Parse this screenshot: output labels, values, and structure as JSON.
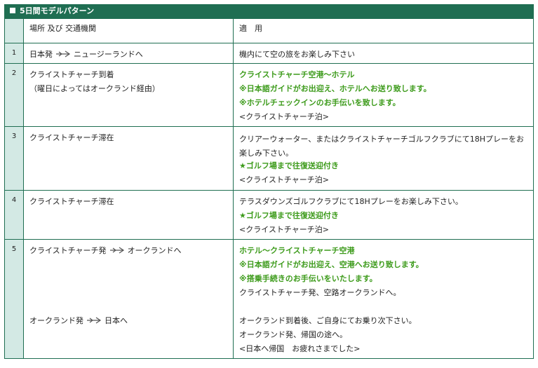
{
  "title": "5日間モデルパターン",
  "headers": {
    "location": "場所 及び 交通機関",
    "usage": "適　用"
  },
  "rows": [
    {
      "num": "1",
      "loc1_pre": "日本発",
      "loc1_post": "ニュージーランドへ",
      "lines": [
        {
          "text": "機内にて空の旅をお楽しみ下さい",
          "style": "normal"
        }
      ]
    },
    {
      "num": "2",
      "loc1": "クライストチャーチ到着",
      "loc2": "（曜日によってはオークランド経由）",
      "lines": [
        {
          "text": "クライストチャーチ空港〜ホテル",
          "style": "green"
        },
        {
          "text": "※日本語ガイドがお出迎え、ホテルへお送り致します。",
          "style": "green"
        },
        {
          "text": "※ホテルチェックインのお手伝いを致します。",
          "style": "green"
        },
        {
          "text": "<クライストチャーチ泊>",
          "style": "normal"
        }
      ]
    },
    {
      "num": "3",
      "loc1": "クライストチャーチ滞在",
      "lines": [
        {
          "text": "クリアーウォーター、またはクライストチャーチゴルフクラブにて18Hプレーをお楽しみ下さい。",
          "style": "wrap"
        },
        {
          "text": "★ゴルフ場まで往復送迎付き",
          "style": "green"
        },
        {
          "text": "<クライストチャーチ泊>",
          "style": "normal"
        }
      ]
    },
    {
      "num": "4",
      "loc1": "クライストチャーチ滞在",
      "lines": [
        {
          "text": "テラスダウンズゴルフクラブにて18Hプレーをお楽しみ下さい。",
          "style": "normal"
        },
        {
          "text": "★ゴルフ場まで往復送迎付き",
          "style": "green"
        },
        {
          "text": "<クライストチャーチ泊>",
          "style": "normal"
        }
      ]
    },
    {
      "num": "5",
      "loc1_pre": "クライストチャーチ発",
      "loc1_post": "オークランドへ",
      "loc2_pre": "オークランド発",
      "loc2_post": "日本へ",
      "lines": [
        {
          "text": "ホテル〜クライストチャーチ空港",
          "style": "green"
        },
        {
          "text": "※日本語ガイドがお出迎え、空港へお送り致します。",
          "style": "green"
        },
        {
          "text": "※搭乗手続きのお手伝いをいたします。",
          "style": "green"
        },
        {
          "text": "クライストチャーチ発、空路オークランドへ。",
          "style": "normal"
        },
        {
          "text": "オークランド到着後、ご自身にてお乗り次下さい。",
          "style": "normal"
        },
        {
          "text": "オークランド発、帰国の途へ。",
          "style": "normal"
        },
        {
          "text": "<日本へ帰国　お疲れさまでした>",
          "style": "normal"
        }
      ]
    }
  ]
}
